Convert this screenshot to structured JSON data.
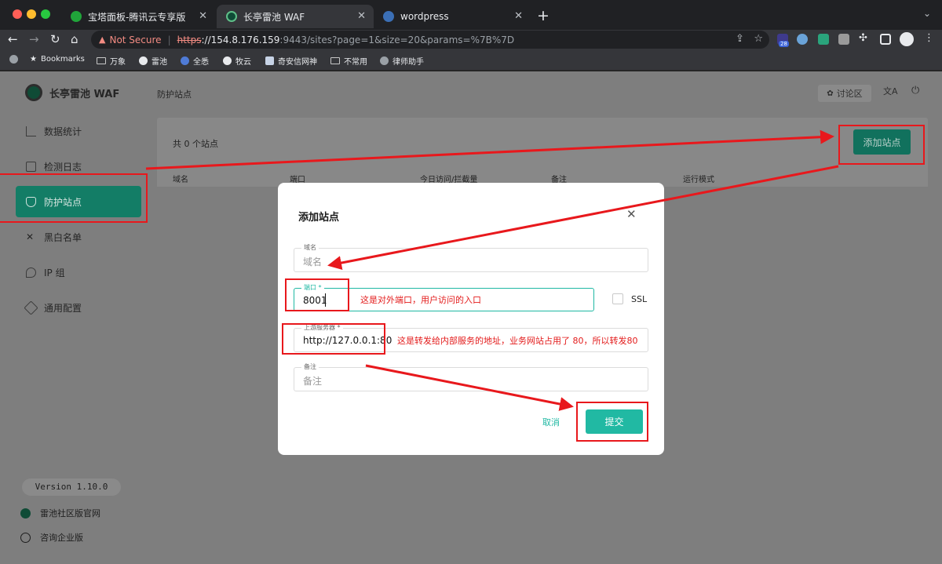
{
  "browser": {
    "tabs": [
      {
        "title": "宝塔面板-腾讯云专享版",
        "favicon_color": "#20a53a"
      },
      {
        "title": "长亭雷池 WAF",
        "favicon_color": "#0f4b36"
      },
      {
        "title": "wordpress",
        "favicon_color": "#3b6fb6"
      }
    ],
    "security_label": "Not Secure",
    "url_scheme": "https",
    "url_host": "://154.8.176.159",
    "url_rest": ":9443/sites?page=1&size=20&params=%7B%7D",
    "extension_badge": "28",
    "bookmarks": [
      "Bookmarks",
      "万象",
      "雷池",
      "全悉",
      "牧云",
      "奇安信网神",
      "不常用",
      "律师助手"
    ]
  },
  "app": {
    "brand": "长亭雷池 WAF",
    "page_title": "防护站点",
    "nav": [
      "数据统计",
      "检测日志",
      "防护站点",
      "黑白名单",
      "IP 组",
      "通用配置"
    ],
    "version": "Version 1.10.0",
    "footer_links": [
      "雷池社区版官网",
      "咨询企业版"
    ],
    "header": {
      "discuss": "讨论区"
    },
    "site_count": "共 0 个站点",
    "add_site_button": "添加站点",
    "table_headers": [
      "域名",
      "端口",
      "今日访问/拦截量",
      "备注",
      "运行模式"
    ]
  },
  "modal": {
    "title": "添加站点",
    "domain": {
      "label": "域名",
      "placeholder": "域名"
    },
    "port": {
      "label": "端口 *",
      "value": "8001"
    },
    "ssl_label": "SSL",
    "upstream": {
      "label": "上游服务器 *",
      "value": "http://127.0.0.1:80"
    },
    "remark": {
      "label": "备注",
      "placeholder": "备注"
    },
    "cancel": "取消",
    "submit": "提交"
  },
  "annotations": {
    "port_note": "这是对外端口，用户访问的入口",
    "upstream_note": "这是转发给内部服务的地址，业务网站占用了 80，所以转发80"
  },
  "colors": {
    "accent": "#21b9a3",
    "annotation_red": "#e8181c",
    "active_nav": "#137d66"
  }
}
